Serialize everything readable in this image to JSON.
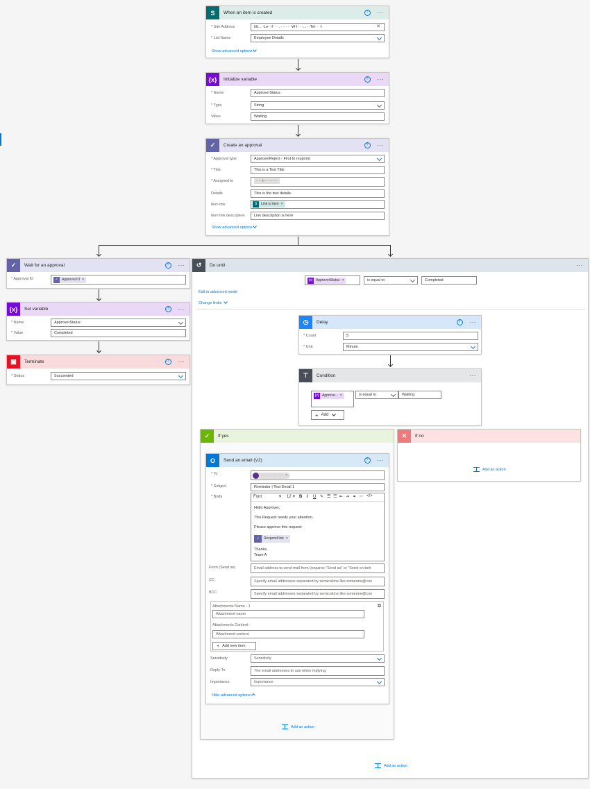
{
  "colors": {
    "sharepoint": "#036c70",
    "variable": "#770bd6",
    "approval": "#6264a7",
    "control": "#1f85ff",
    "condition": "#484f58",
    "terminate": "#e81123",
    "yes": "#6bb700",
    "no": "#f0797b",
    "outlook": "#0078d4",
    "accent": "#0078d4"
  },
  "trigger": {
    "title": "When an item is created",
    "icon": "sharepoint-icon",
    "site_address_label": "* Site Address",
    "site_address_value": "htt... ·Le· ·f· · ·..· ··· · ·W·l· · ·...· ·Tel· · ·t",
    "list_name_label": "* List Name",
    "list_name_value": "Employee Details",
    "advanced": "Show advanced options"
  },
  "init_var": {
    "title": "Initialize variable",
    "icon": "variable-icon",
    "name_label": "* Name",
    "name_value": "ApproverStatus",
    "type_label": "* Type",
    "type_value": "String",
    "value_label": "Value",
    "value_value": "Waiting"
  },
  "create_approval": {
    "title": "Create an approval",
    "icon": "approval-icon",
    "type_label": "* Approval type",
    "type_value": "Approve/Reject - First to respond",
    "title_label": "* Title",
    "title_value": "This is a Test Title",
    "assigned_label": "* Assigned to",
    "assigned_value": "·····t··· ·······",
    "details_label": "Details",
    "details_value": "This is the test details.",
    "item_link_label": "Item link",
    "item_link_token": "Link to item",
    "item_link_desc_label": "Item link description",
    "item_link_desc_value": "Link description is here",
    "advanced": "Show advanced options"
  },
  "wait_approval": {
    "title": "Wait for an approval",
    "id_label": "* Approval ID",
    "id_token": "Approval ID"
  },
  "set_var": {
    "title": "Set variable",
    "name_label": "* Name",
    "name_value": "ApproverStatus",
    "value_label": "* Value",
    "value_value": "Completed"
  },
  "terminate": {
    "title": "Terminate",
    "status_label": "* Status",
    "status_value": "Succeeded"
  },
  "do_until": {
    "title": "Do until",
    "cond_token": "ApproverStatus",
    "cond_op": "is equal to",
    "cond_value": "Completed",
    "edit_advanced": "Edit in advanced mode",
    "change_limits": "Change limits",
    "add_action": "Add an action"
  },
  "delay": {
    "title": "Delay",
    "count_label": "* Count",
    "count_value": "5",
    "unit_label": "* Unit",
    "unit_value": "Minute"
  },
  "condition": {
    "title": "Condition",
    "token": "Approve...",
    "op": "is equal to",
    "value": "Waiting",
    "add": "Add"
  },
  "if_yes": {
    "title": "If yes",
    "add_action": "Add an action"
  },
  "if_no": {
    "title": "If no",
    "add_action": "Add an action"
  },
  "email": {
    "title": "Send an email (V2)",
    "to_label": "* To",
    "to_value": "·· · ·· ·   ·· · ···",
    "subject_label": "* Subject",
    "subject_value": "Reminder | Test Email 1",
    "body_label": "* Body",
    "font": "Font",
    "size": "12",
    "body_lines": [
      "Hello Approver,",
      "This Request needs your attention.",
      "Please approve this request:"
    ],
    "respond_token": "Respond link",
    "closing": [
      "Thanks,",
      "Team A"
    ],
    "from_label": "From (Send as)",
    "from_ph": "Email address to send mail from (requires \"Send as\" or \"Send on beh",
    "cc_label": "CC",
    "cc_ph": "Specify email addresses separated by semicolons like someone@con",
    "bcc_label": "BCC",
    "bcc_ph": "Specify email addresses separated by semicolons like someone@con",
    "attach_name_label": "Attachments Name - 1",
    "attach_name_ph": "Attachment name",
    "attach_content_label": "Attachments Content -",
    "attach_content_ph": "Attachment content",
    "add_new_item": "Add new item",
    "sensitivity_label": "Sensitivity",
    "sensitivity_ph": "Sensitivity",
    "reply_label": "Reply To",
    "reply_ph": "The email addresses to use when replying.",
    "importance_label": "Importance",
    "importance_ph": "Importance",
    "hide_advanced": "Hide advanced options"
  }
}
